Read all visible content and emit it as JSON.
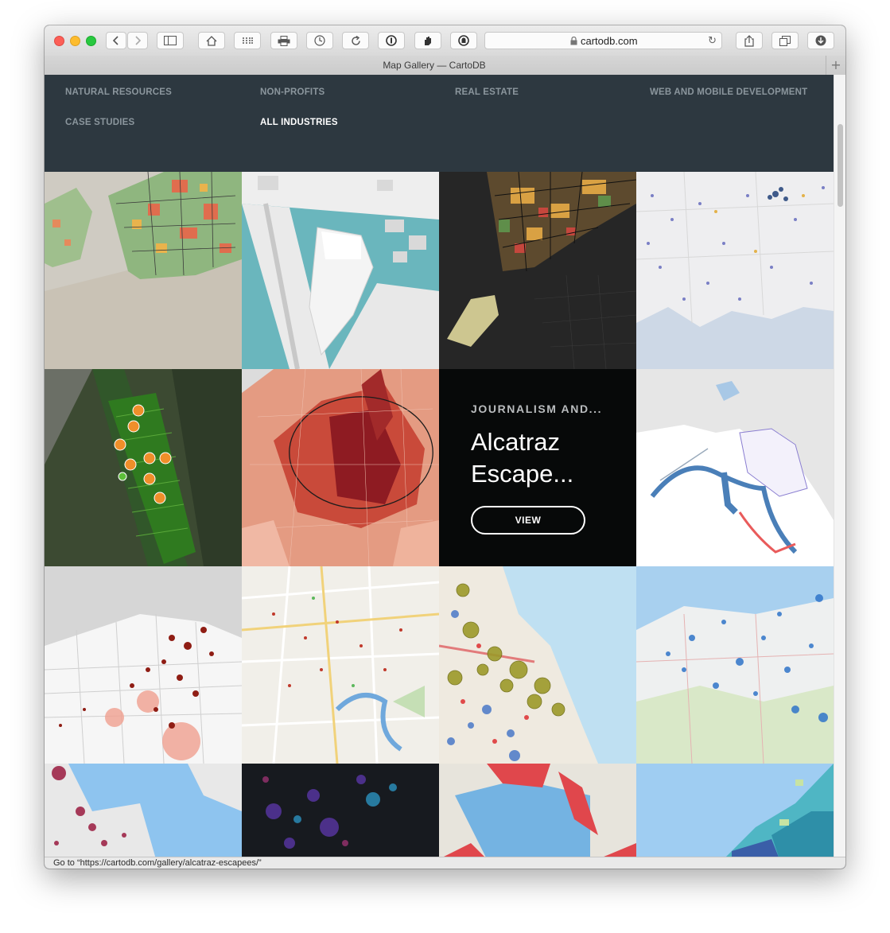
{
  "window": {
    "tab_title": "Map Gallery — CartoDB",
    "new_tab": "+"
  },
  "toolbar": {
    "url": "cartodb.com"
  },
  "nav": {
    "items": [
      {
        "label": "NATURAL RESOURCES",
        "active": false
      },
      {
        "label": "NON-PROFITS",
        "active": false
      },
      {
        "label": "REAL ESTATE",
        "active": false
      },
      {
        "label": "WEB AND MOBILE DEVELOPMENT",
        "active": false
      },
      {
        "label": "CASE STUDIES",
        "active": false
      },
      {
        "label": "ALL INDUSTRIES",
        "active": true
      }
    ]
  },
  "gallery": {
    "hover": {
      "category": "JOURNALISM AND...",
      "title_line1": "Alcatraz",
      "title_line2": "Escape...",
      "button": "VIEW"
    }
  },
  "status": {
    "text": "Go to “https://cartodb.com/gallery/alcatraz-escapees/”"
  },
  "colors": {
    "nav_bg": "#2d3840",
    "nav_text": "#8b969d",
    "nav_active": "#ffffff",
    "overlay_bg": "#060606"
  }
}
